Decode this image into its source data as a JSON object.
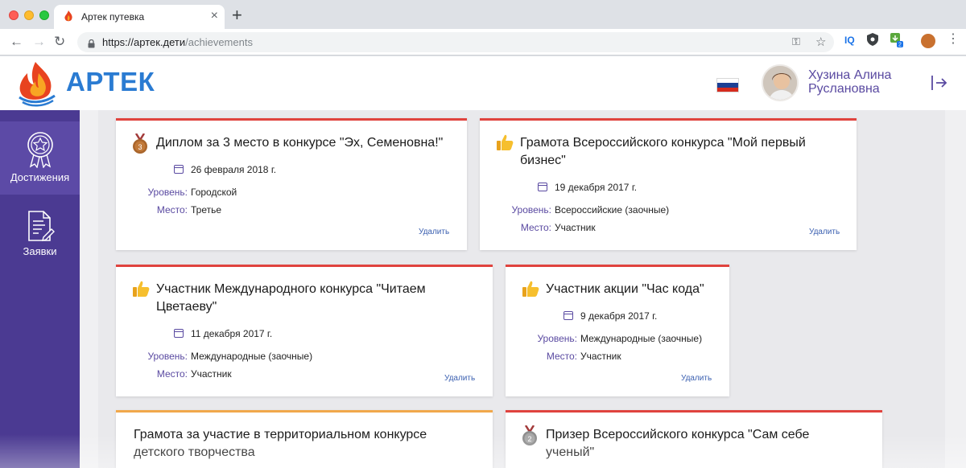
{
  "browser": {
    "tab_title": "Артек путевка",
    "url_host": "https://артек.дети",
    "url_path": "/achievements",
    "ext_iq_label": "IQ"
  },
  "site": {
    "logo_text": "АРТЕК",
    "user_name_line1": "Хузина Алина",
    "user_name_line2": "Руслановна",
    "colors": {
      "accent": "#4b3a92",
      "logo": "#2a7bd2",
      "card_border": "#e0433e",
      "card_border_alt": "#f1a84b"
    }
  },
  "sidebar": {
    "items": [
      {
        "label": "Достижения",
        "icon": "award-icon",
        "active": true
      },
      {
        "label": "Заявки",
        "icon": "document-icon",
        "active": false
      }
    ]
  },
  "labels": {
    "level": "Уровень:",
    "place": "Место:",
    "delete": "Удалить"
  },
  "achievements": [
    {
      "icon": "bronze-medal-icon",
      "title_line1": "Диплом за 3 место в конкурсе \"Эх, Семеновна!\"",
      "title_line2": "",
      "date": "26 февраля 2018 г.",
      "level": "Городской",
      "place": "Третье"
    },
    {
      "icon": "thumbs-up-icon",
      "title_line1": "Грамота Всероссийского конкурса \"Мой первый",
      "title_line2": "бизнес\"",
      "date": "19 декабря 2017 г.",
      "level": "Всероссийские (заочные)",
      "place": "Участник"
    },
    {
      "icon": "thumbs-up-icon",
      "title_line1": "Участник Международного конкурса \"Читаем",
      "title_line2": "Цветаеву\"",
      "date": "11 декабря 2017 г.",
      "level": "Международные (заочные)",
      "place": "Участник"
    },
    {
      "icon": "thumbs-up-icon",
      "title_line1": "Участник акции \"Час кода\"",
      "title_line2": "",
      "date": "9 декабря 2017 г.",
      "level": "Международные (заочные)",
      "place": "Участник"
    },
    {
      "icon": "",
      "title_line1": "Грамота за участие в территориальном конкурсе",
      "title_line2": "детского творчества"
    },
    {
      "icon": "silver-medal-icon",
      "title_line1": "Призер Всероссийского конкурса \"Сам себе",
      "title_line2": "ученый\""
    }
  ]
}
